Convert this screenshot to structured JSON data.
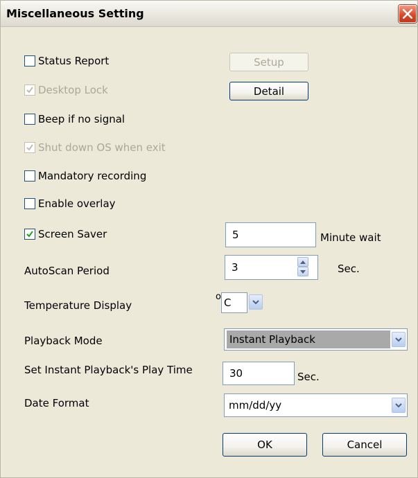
{
  "window": {
    "title": "Miscellaneous Setting",
    "close_symbol": "×"
  },
  "checkboxes": [
    {
      "label": "Status Report",
      "checked": false,
      "enabled": true
    },
    {
      "label": "Desktop Lock",
      "checked": true,
      "enabled": false
    },
    {
      "label": "Beep if no signal",
      "checked": false,
      "enabled": true
    },
    {
      "label": "Shut down OS when exit",
      "checked": true,
      "enabled": false
    },
    {
      "label": "Mandatory recording",
      "checked": false,
      "enabled": true
    },
    {
      "label": "Enable overlay",
      "checked": false,
      "enabled": true
    },
    {
      "label": "Screen Saver",
      "checked": true,
      "enabled": true
    }
  ],
  "buttons": {
    "setup": "Setup",
    "detail": "Detail",
    "ok": "OK",
    "cancel": "Cancel"
  },
  "screen_saver": {
    "value": "5",
    "unit": "Minute wait"
  },
  "autoscan": {
    "label": "AutoScan Period",
    "value": "3",
    "unit": "Sec."
  },
  "temperature": {
    "label": "Temperature Display",
    "degree": "o",
    "unit": "C"
  },
  "playback": {
    "label": "Playback Mode",
    "value": "Instant Playback"
  },
  "instant_playback": {
    "label": "Set Instant Playback's Play Time",
    "value": "30",
    "unit": "Sec."
  },
  "date_format": {
    "label": "Date Format",
    "value": "mm/dd/yy"
  },
  "icons": {
    "close": "close-icon",
    "check": "checkmark-icon",
    "spin_up": "spin-up-icon",
    "spin_down": "spin-down-icon",
    "dropdown": "chevron-down-icon"
  },
  "colors": {
    "dialog_bg": "#ece9d8",
    "close_red": "#d94b2a",
    "check_green": "#21a121",
    "field_border": "#7f9db9",
    "button_border": "#003c74",
    "disabled_text": "#aca899"
  }
}
